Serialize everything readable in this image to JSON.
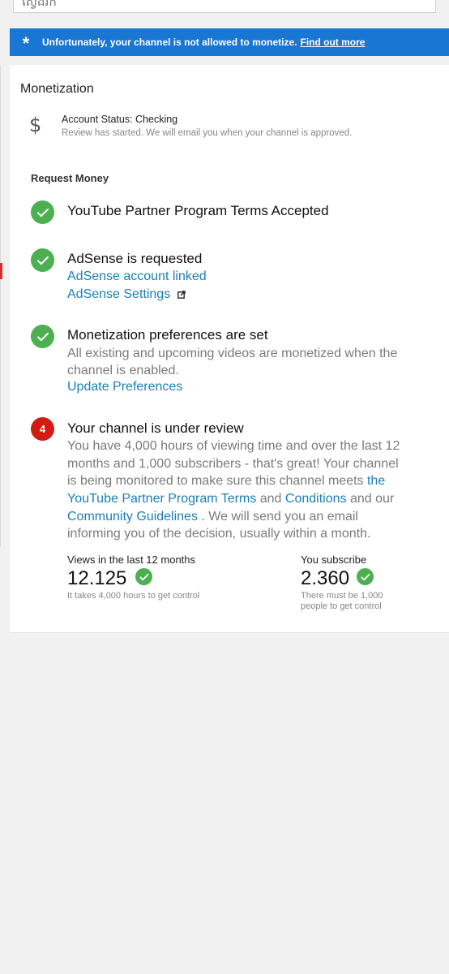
{
  "search": {
    "value": "ស្វែងរក"
  },
  "banner": {
    "icon": "star-icon",
    "text": "Unfortunately, your channel is not allowed to monetize.",
    "link": "Find out more",
    "color": "#1976d2"
  },
  "card": {
    "title": "Monetization",
    "status": {
      "icon": "dollar-icon",
      "title": "Account Status: Checking",
      "subtitle": "Review has started. We will email you when your channel is approved."
    },
    "section_title": "Request Money",
    "steps": [
      {
        "title": "YouTube Partner Program Terms Accepted",
        "state": "done"
      },
      {
        "title": "AdSense is requested",
        "links": [
          "AdSense account linked",
          "AdSense Settings"
        ],
        "state": "done"
      },
      {
        "title": "Monetization preferences are set",
        "lines": [
          "All existing and upcoming videos are monetized when the",
          "channel is enabled."
        ],
        "link": "Update Preferences",
        "state": "done"
      },
      {
        "number": "4",
        "title": "Your channel is under review",
        "state": "pending",
        "lines": [
          "You have 4,000 hours of viewing time and over the last 12",
          "months and 1,000 subscribers - that's great! Your channel",
          "is being monitored to make sure this channel meets",
          "the",
          "YouTube Partner Program Terms",
          "and",
          "Conditions",
          "and our",
          "Community Guidelines",
          ". We will send you an email",
          "informing you of the decision, usually within a month."
        ]
      }
    ],
    "stats": {
      "views": {
        "label": "Views in the last 12 months",
        "value": "12.125",
        "note": "It takes 4,000 hours to get control"
      },
      "subs": {
        "label": "You subscribe",
        "value": "2.360",
        "note_lines": [
          "There must be 1,000",
          "people to get control"
        ]
      }
    }
  }
}
